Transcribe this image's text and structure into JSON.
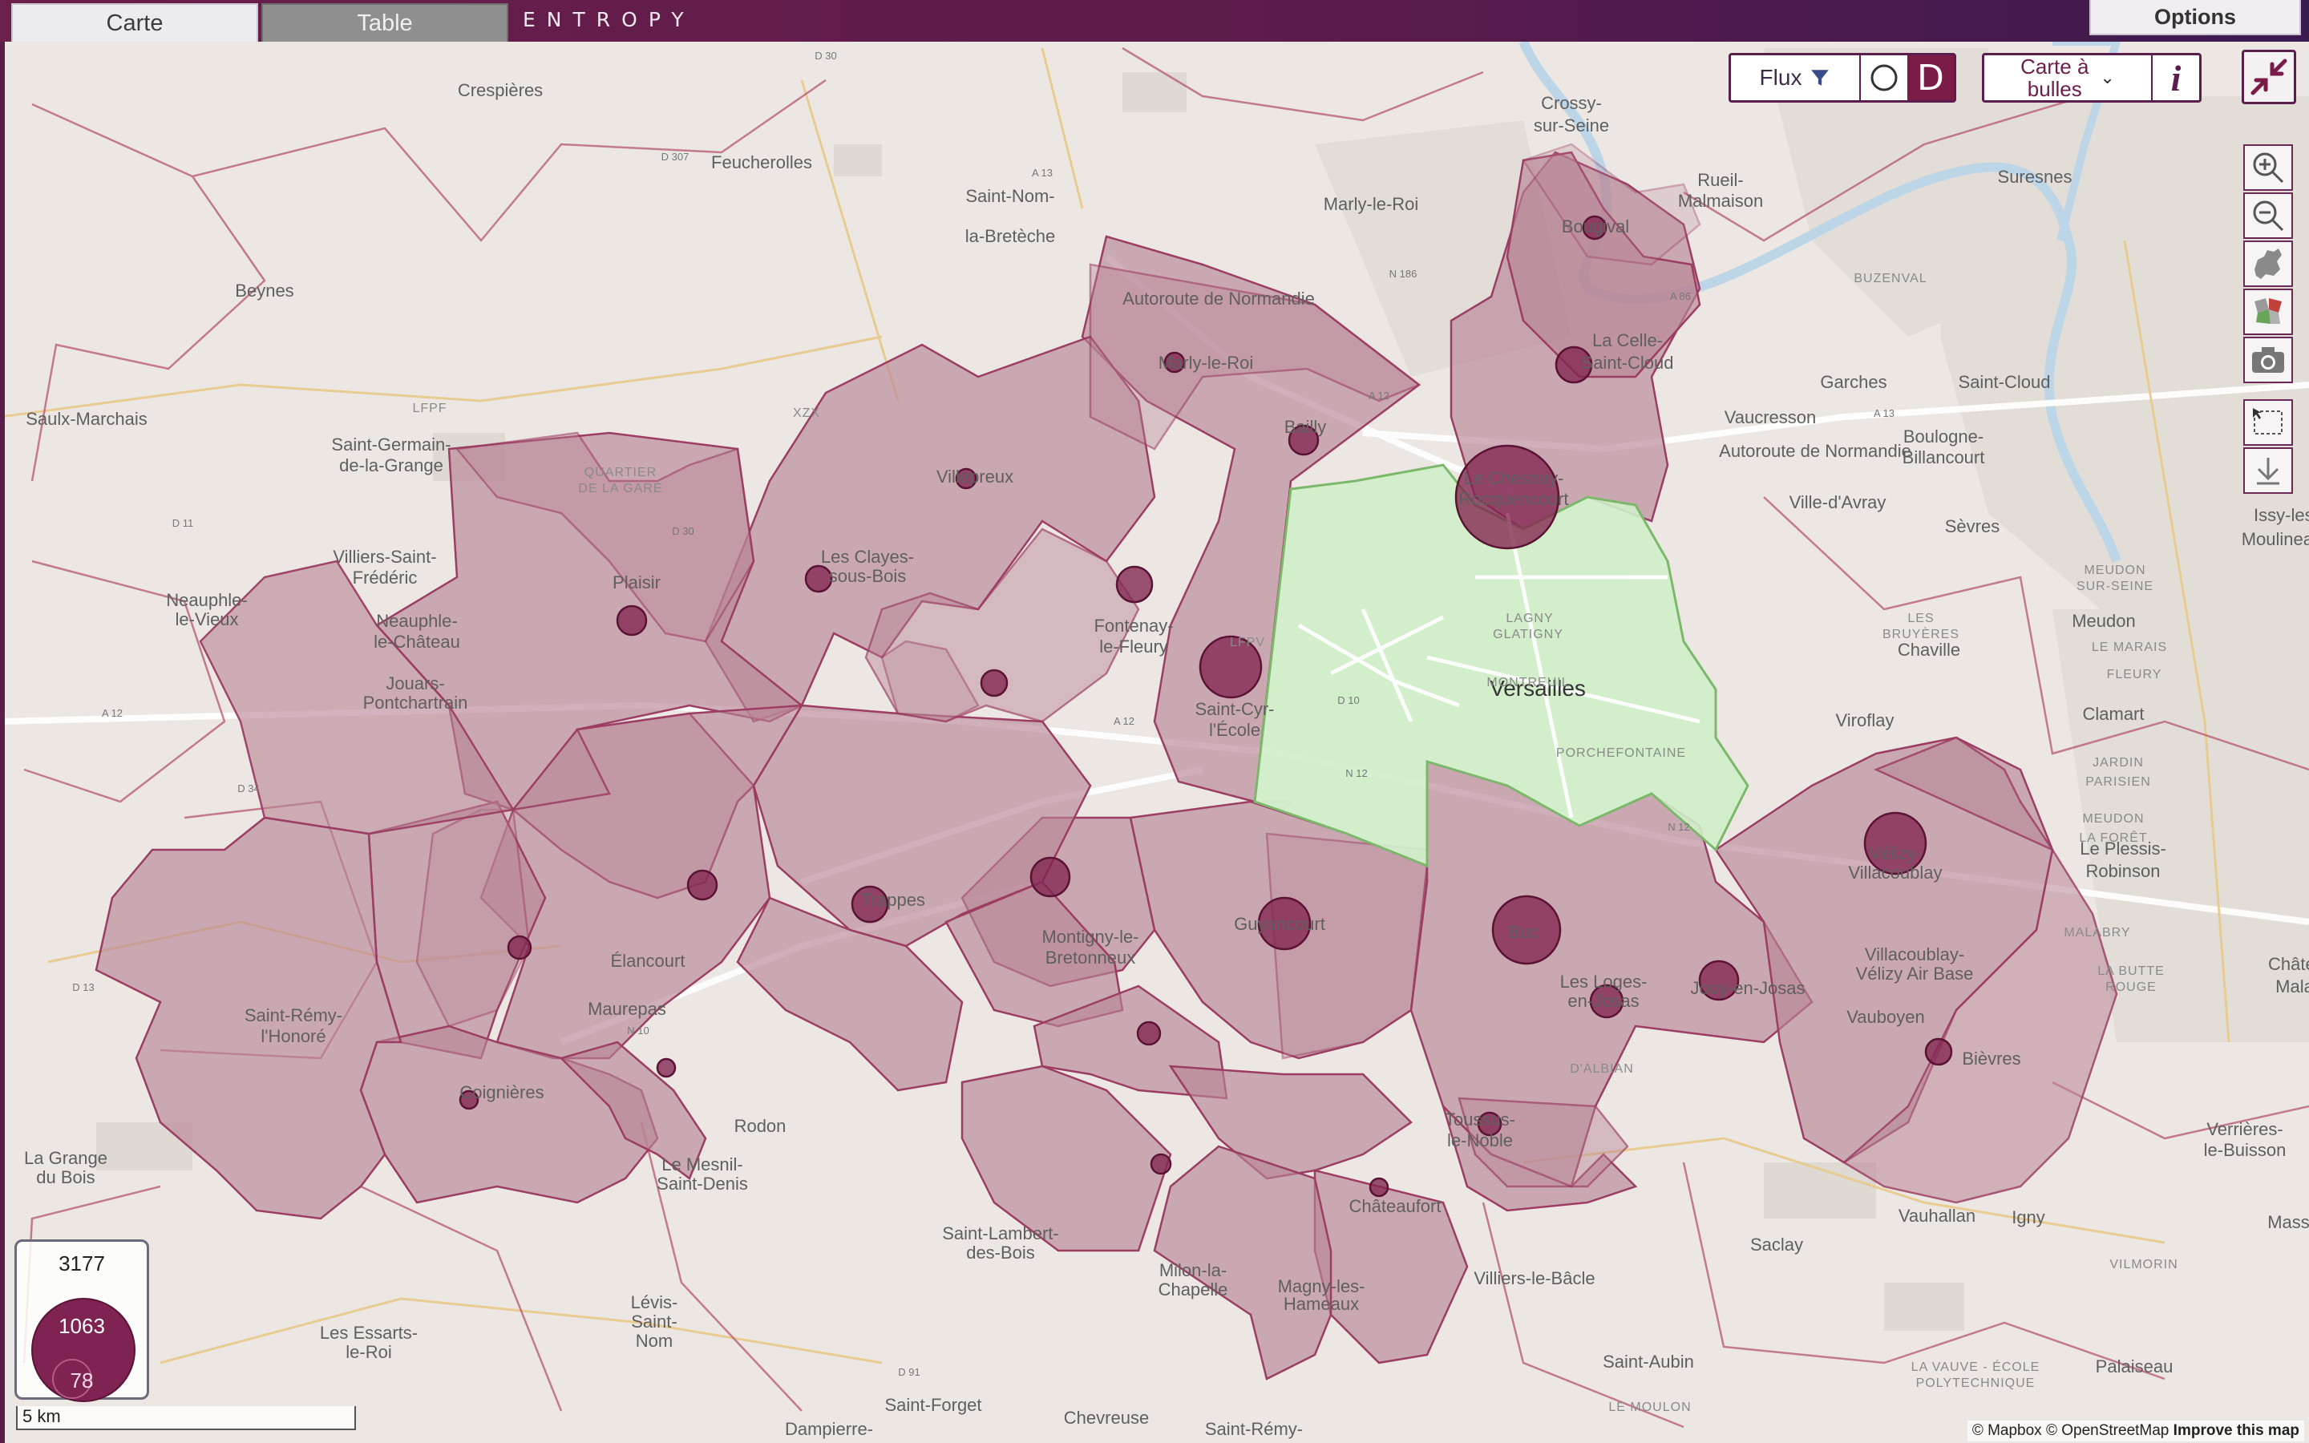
{
  "tabs": [
    {
      "label": "Carte",
      "active": true
    },
    {
      "label": "Table",
      "active": false
    }
  ],
  "brand": "ENTROPY",
  "options_label": "Options",
  "controls": {
    "flux_label": "Flux",
    "origin_label": "O",
    "destination_label": "D",
    "mode_label_line1": "Carte à",
    "mode_label_line2": "bulles",
    "info_label": "i"
  },
  "toolbar_icons": [
    "zoom-in-icon",
    "zoom-out-icon",
    "europe-map-icon",
    "choropleth-icon",
    "camera-icon",
    "select-area-icon",
    "download-icon"
  ],
  "legend": {
    "total": "3177",
    "mid": "1063",
    "min": "78"
  },
  "scale_label": "5 km",
  "attribution": {
    "mapbox": "© Mapbox",
    "osm": "© OpenStreetMap",
    "improve": "Improve this map"
  },
  "colors": {
    "accent": "#7b1c48",
    "zone_fill": "#b98596",
    "highlight_fill": "#cfeec8",
    "bubble": "#82254f"
  },
  "map_labels": [
    "Crespières",
    "Feucherolles",
    "Saint-Nom-",
    "la-Bretèche",
    "Marly-le-Roi",
    "Crossy-",
    "sur-Seine",
    "Rueil-",
    "Malmaison",
    "Suresnes",
    "Beynes",
    "Saulx-Marchais",
    "Saint-Germain-",
    "de-la-Grange",
    "Villiers-Saint-",
    "Frédéric",
    "Neauphle-",
    "le-Vieux",
    "Neauphle-",
    "le-Château",
    "Jouars-",
    "Pontchartrain",
    "Bougival",
    "La Celle-",
    "Saint-Cloud",
    "Garches",
    "Vaucresson",
    "Saint-Cloud",
    "Boulogne-",
    "Billancourt",
    "Ville-d'Avray",
    "Sèvres",
    "Issy-les-",
    "Moulineaux",
    "Meudon",
    "Chaville",
    "Viroflay",
    "Clamart",
    "Le Plessis-",
    "Robinson",
    "Châte-",
    "Mala",
    "Marly-le-Roi",
    "Bailly",
    "Villepreux",
    "Les Clayes-",
    "sous-Bois",
    "Plaisir",
    "Fontenay-",
    "le-Fleury",
    "Saint-Cyr-",
    "l'École",
    "Le Chesnay-",
    "Rocquencourt",
    "Versailles",
    "Vélizy-",
    "Villacoublay",
    "Trappes",
    "Élancourt",
    "Maurepas",
    "Coignières",
    "Guyancourt",
    "Montigny-le-",
    "Bretonneux",
    "Buc",
    "Les Loges-",
    "en-Josas",
    "Jouy-en-Josas",
    "Villacoublay-",
    "Vélizy Air Base",
    "Vauboyen",
    "Bièvres",
    "Toussus-",
    "le-Noble",
    "Châteaufort",
    "Saint-Rémy-",
    "l'Honoré",
    "Le Mesnil-",
    "Saint-Denis",
    "Rodon",
    "La Grange",
    "du Bois",
    "Lévis-",
    "Saint-",
    "Nom",
    "Les Essarts-",
    "le-Roi",
    "Saint-Lambert-",
    "des-Bois",
    "Milon-la-",
    "Chapelle",
    "Magny-les-",
    "Hameaux",
    "Villiers-le-Bâcle",
    "Saclay",
    "Vauhallan",
    "Igny",
    "Massy",
    "Palaiseau",
    "Verrières-",
    "le-Buisson",
    "Saint-Aubin",
    "Chevreuse",
    "Saint-Forget",
    "Dampierre-",
    "Saint-Rémy-",
    "Autoroute de Normandie",
    "Autoroute de Normandie",
    "LFPF",
    "XZX",
    "LFPV",
    "MONTREUIL",
    "PORCHEFONTAINE",
    "LAGNY",
    "GLATIGNY",
    "QUARTIER",
    "DE LA GARE",
    "BUZENVAL",
    "MEUDON",
    "SUR-SEINE",
    "LES",
    "BRUYÈRES",
    "LE MARAIS",
    "FLEURY",
    "JARDIN",
    "PARISIEN",
    "MEUDON",
    "LA FORÊT",
    "MALABRY",
    "LA BUTTE",
    "ROUGE",
    "D'ALBIAN",
    "LA VAUVE - ÉCOLE",
    "POLYTECHNIQUE",
    "VILMORIN",
    "LE MOULON",
    "D 30",
    "D 307",
    "A 13",
    "N 186",
    "A 12",
    "A 86",
    "A 13",
    "D 11",
    "D 30",
    "A 12",
    "D 34",
    "A 12",
    "D 10",
    "N 12",
    "N 12",
    "N 10",
    "D 13",
    "D 91"
  ]
}
